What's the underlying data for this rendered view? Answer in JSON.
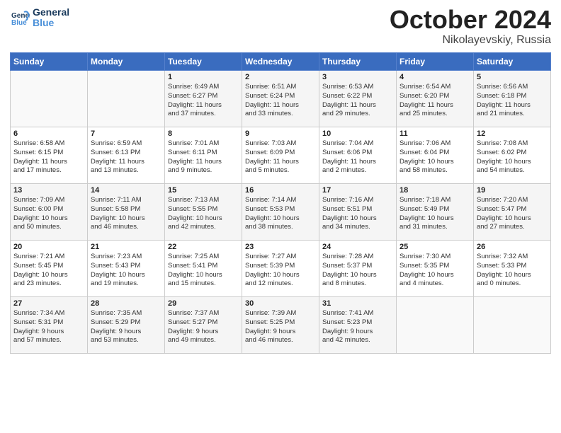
{
  "logo": {
    "line1": "General",
    "line2": "Blue"
  },
  "title": "October 2024",
  "location": "Nikolayevskiy, Russia",
  "days_header": [
    "Sunday",
    "Monday",
    "Tuesday",
    "Wednesday",
    "Thursday",
    "Friday",
    "Saturday"
  ],
  "weeks": [
    [
      {
        "day": "",
        "content": ""
      },
      {
        "day": "",
        "content": ""
      },
      {
        "day": "1",
        "content": "Sunrise: 6:49 AM\nSunset: 6:27 PM\nDaylight: 11 hours\nand 37 minutes."
      },
      {
        "day": "2",
        "content": "Sunrise: 6:51 AM\nSunset: 6:24 PM\nDaylight: 11 hours\nand 33 minutes."
      },
      {
        "day": "3",
        "content": "Sunrise: 6:53 AM\nSunset: 6:22 PM\nDaylight: 11 hours\nand 29 minutes."
      },
      {
        "day": "4",
        "content": "Sunrise: 6:54 AM\nSunset: 6:20 PM\nDaylight: 11 hours\nand 25 minutes."
      },
      {
        "day": "5",
        "content": "Sunrise: 6:56 AM\nSunset: 6:18 PM\nDaylight: 11 hours\nand 21 minutes."
      }
    ],
    [
      {
        "day": "6",
        "content": "Sunrise: 6:58 AM\nSunset: 6:15 PM\nDaylight: 11 hours\nand 17 minutes."
      },
      {
        "day": "7",
        "content": "Sunrise: 6:59 AM\nSunset: 6:13 PM\nDaylight: 11 hours\nand 13 minutes."
      },
      {
        "day": "8",
        "content": "Sunrise: 7:01 AM\nSunset: 6:11 PM\nDaylight: 11 hours\nand 9 minutes."
      },
      {
        "day": "9",
        "content": "Sunrise: 7:03 AM\nSunset: 6:09 PM\nDaylight: 11 hours\nand 5 minutes."
      },
      {
        "day": "10",
        "content": "Sunrise: 7:04 AM\nSunset: 6:06 PM\nDaylight: 11 hours\nand 2 minutes."
      },
      {
        "day": "11",
        "content": "Sunrise: 7:06 AM\nSunset: 6:04 PM\nDaylight: 10 hours\nand 58 minutes."
      },
      {
        "day": "12",
        "content": "Sunrise: 7:08 AM\nSunset: 6:02 PM\nDaylight: 10 hours\nand 54 minutes."
      }
    ],
    [
      {
        "day": "13",
        "content": "Sunrise: 7:09 AM\nSunset: 6:00 PM\nDaylight: 10 hours\nand 50 minutes."
      },
      {
        "day": "14",
        "content": "Sunrise: 7:11 AM\nSunset: 5:58 PM\nDaylight: 10 hours\nand 46 minutes."
      },
      {
        "day": "15",
        "content": "Sunrise: 7:13 AM\nSunset: 5:55 PM\nDaylight: 10 hours\nand 42 minutes."
      },
      {
        "day": "16",
        "content": "Sunrise: 7:14 AM\nSunset: 5:53 PM\nDaylight: 10 hours\nand 38 minutes."
      },
      {
        "day": "17",
        "content": "Sunrise: 7:16 AM\nSunset: 5:51 PM\nDaylight: 10 hours\nand 34 minutes."
      },
      {
        "day": "18",
        "content": "Sunrise: 7:18 AM\nSunset: 5:49 PM\nDaylight: 10 hours\nand 31 minutes."
      },
      {
        "day": "19",
        "content": "Sunrise: 7:20 AM\nSunset: 5:47 PM\nDaylight: 10 hours\nand 27 minutes."
      }
    ],
    [
      {
        "day": "20",
        "content": "Sunrise: 7:21 AM\nSunset: 5:45 PM\nDaylight: 10 hours\nand 23 minutes."
      },
      {
        "day": "21",
        "content": "Sunrise: 7:23 AM\nSunset: 5:43 PM\nDaylight: 10 hours\nand 19 minutes."
      },
      {
        "day": "22",
        "content": "Sunrise: 7:25 AM\nSunset: 5:41 PM\nDaylight: 10 hours\nand 15 minutes."
      },
      {
        "day": "23",
        "content": "Sunrise: 7:27 AM\nSunset: 5:39 PM\nDaylight: 10 hours\nand 12 minutes."
      },
      {
        "day": "24",
        "content": "Sunrise: 7:28 AM\nSunset: 5:37 PM\nDaylight: 10 hours\nand 8 minutes."
      },
      {
        "day": "25",
        "content": "Sunrise: 7:30 AM\nSunset: 5:35 PM\nDaylight: 10 hours\nand 4 minutes."
      },
      {
        "day": "26",
        "content": "Sunrise: 7:32 AM\nSunset: 5:33 PM\nDaylight: 10 hours\nand 0 minutes."
      }
    ],
    [
      {
        "day": "27",
        "content": "Sunrise: 7:34 AM\nSunset: 5:31 PM\nDaylight: 9 hours\nand 57 minutes."
      },
      {
        "day": "28",
        "content": "Sunrise: 7:35 AM\nSunset: 5:29 PM\nDaylight: 9 hours\nand 53 minutes."
      },
      {
        "day": "29",
        "content": "Sunrise: 7:37 AM\nSunset: 5:27 PM\nDaylight: 9 hours\nand 49 minutes."
      },
      {
        "day": "30",
        "content": "Sunrise: 7:39 AM\nSunset: 5:25 PM\nDaylight: 9 hours\nand 46 minutes."
      },
      {
        "day": "31",
        "content": "Sunrise: 7:41 AM\nSunset: 5:23 PM\nDaylight: 9 hours\nand 42 minutes."
      },
      {
        "day": "",
        "content": ""
      },
      {
        "day": "",
        "content": ""
      }
    ]
  ]
}
